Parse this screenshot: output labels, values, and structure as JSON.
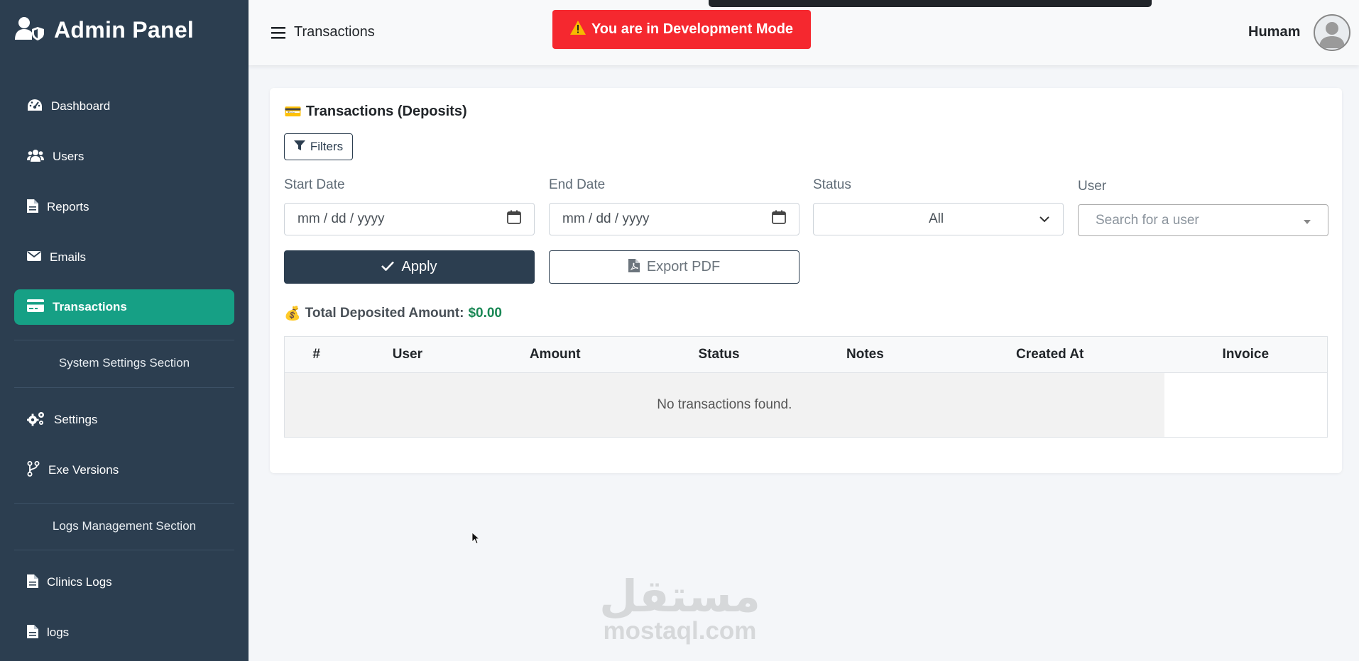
{
  "sidebar": {
    "brand": "Admin Panel",
    "items": [
      {
        "label": "Dashboard",
        "icon": "gauge-icon"
      },
      {
        "label": "Users",
        "icon": "users-icon"
      },
      {
        "label": "Reports",
        "icon": "file-icon"
      },
      {
        "label": "Emails",
        "icon": "envelope-icon"
      },
      {
        "label": "Transactions",
        "icon": "credit-card-icon",
        "active": true
      }
    ],
    "sections": {
      "system": "System Settings Section",
      "logs": "Logs Management Section"
    },
    "settings_items": [
      {
        "label": "Settings",
        "icon": "gears-icon"
      },
      {
        "label": "Exe Versions",
        "icon": "code-branch-icon"
      }
    ],
    "log_items": [
      {
        "label": "Clinics Logs",
        "icon": "file-icon"
      },
      {
        "label": "logs",
        "icon": "file-icon"
      }
    ]
  },
  "topbar": {
    "title": "Transactions",
    "dev_banner": "You are in Development Mode",
    "user_name": "Humam"
  },
  "card": {
    "title_emoji": "💳",
    "title": "Transactions (Deposits)",
    "filters_label": "Filters",
    "start_date_label": "Start Date",
    "start_date_placeholder": "mm / dd / yyyy",
    "end_date_label": "End Date",
    "end_date_placeholder": "mm / dd / yyyy",
    "status_label": "Status",
    "status_value": "All",
    "user_label": "User",
    "user_placeholder": "Search for a user",
    "apply_label": "Apply",
    "export_label": "Export PDF",
    "total_emoji": "💰",
    "total_label": "Total Deposited Amount:",
    "total_value": "$0.00"
  },
  "table": {
    "columns": [
      "#",
      "User",
      "Amount",
      "Status",
      "Notes",
      "Created At",
      "Invoice"
    ],
    "empty_message": "No transactions found."
  },
  "watermark": {
    "arabic": "مستقل",
    "latin": "mostaql.com"
  },
  "colors": {
    "sidebar": "#2c3e50",
    "active": "#16a085",
    "danger": "#f5282f",
    "success": "#198754"
  }
}
